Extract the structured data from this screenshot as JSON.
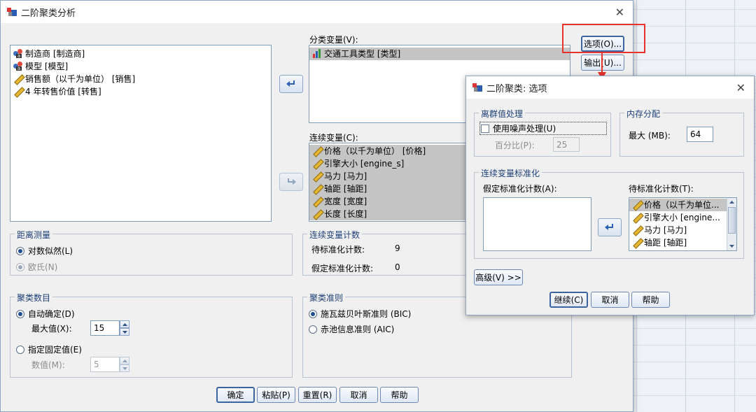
{
  "main_dialog": {
    "title": "二阶聚类分析",
    "source_vars": [
      "制造商 [制造商]",
      "模型 [模型]",
      "销售额（以千为单位） [销售]",
      "4 年转售价值 [转售]"
    ],
    "categorical": {
      "label": "分类变量(V):",
      "items": [
        "交通工具类型 [类型]"
      ]
    },
    "continuous": {
      "label": "连续变量(C):",
      "items": [
        "价格（以千为单位） [价格]",
        "引擎大小 [engine_s]",
        "马力 [马力]",
        "轴距 [轴距]",
        "宽度 [宽度]",
        "长度 [长度]"
      ]
    },
    "options_button": "选项(O)...",
    "output_button": "输出(U)...",
    "distance": {
      "title": "距离测量",
      "log_likelihood": "对数似然(L)",
      "euclidean": "欧氏(N)"
    },
    "cont_count": {
      "title": "连续变量计数",
      "to_std_label": "待标准化计数:",
      "to_std_value": "9",
      "assumed_label": "假定标准化计数:",
      "assumed_value": "0"
    },
    "num_clusters": {
      "title": "聚类数目",
      "auto": "自动确定(D)",
      "max_label": "最大值(X):",
      "max_value": "15",
      "fixed": "指定固定值(E)",
      "num_label": "数值(M):",
      "num_value": "5"
    },
    "criterion": {
      "title": "聚类准则",
      "bic": "施瓦兹贝叶斯准则 (BIC)",
      "aic": "赤池信息准则 (AIC)"
    },
    "buttons": [
      "确定",
      "粘贴(P)",
      "重置(R)",
      "取消",
      "帮助"
    ]
  },
  "options_dialog": {
    "title": "二阶聚类: 选项",
    "outlier": {
      "title": "离群值处理",
      "noise_label": "使用噪声处理(U)",
      "percent_label": "百分比(P):",
      "percent_value": "25"
    },
    "memory": {
      "title": "内存分配",
      "max_label": "最大 (MB):",
      "max_value": "64"
    },
    "std": {
      "title": "连续变量标准化",
      "assumed_label": "假定标准化计数(A):",
      "to_std_label": "待标准化计数(T):",
      "to_std_items": [
        "价格（以千为单位...",
        "引擎大小 [engine...",
        "马力 [马力]",
        "轴距 [轴距]"
      ]
    },
    "advanced_button": "高级(V) >>",
    "buttons": [
      "继续(C)",
      "取消",
      "帮助"
    ]
  },
  "colors": {
    "accent": "#1e3f78",
    "highlight_box": "#e8332d",
    "selection": "#c5c5c5"
  }
}
